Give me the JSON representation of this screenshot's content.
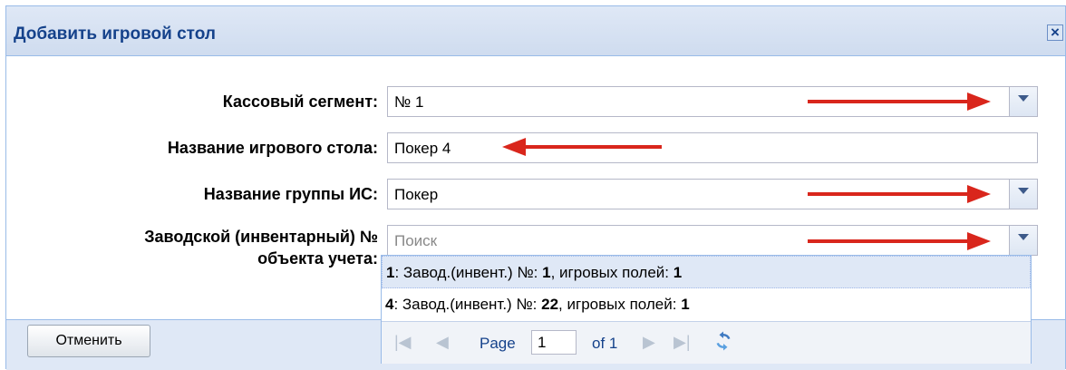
{
  "dialog": {
    "title": "Добавить игровой стол",
    "close_icon": "close-icon"
  },
  "form": {
    "cash_segment_label": "Кассовый сегмент:",
    "cash_segment_value": "№ 1",
    "table_name_label": "Название игрового стола:",
    "table_name_value": "Покер 4",
    "group_name_label": "Название группы ИС:",
    "group_name_value": "Покер",
    "serial_label_line1": "Заводской (инвентарный) №",
    "serial_label_line2": "объекта учета:",
    "serial_placeholder": "Поиск"
  },
  "dropdown": {
    "items": [
      {
        "id": "1",
        "prefix": ": Завод.(инвент.) №: ",
        "serial": "1",
        "mid": ", игровых полей: ",
        "fields": "1"
      },
      {
        "id": "4",
        "prefix": ": Завод.(инвент.) №: ",
        "serial": "22",
        "mid": ", игровых полей: ",
        "fields": "1"
      }
    ],
    "pager": {
      "page_label": "Page",
      "page_value": "1",
      "of_label": "of 1"
    }
  },
  "footer": {
    "cancel_label": "Отменить"
  },
  "colors": {
    "annotation_arrow": "#d9261c",
    "title": "#15428b"
  }
}
